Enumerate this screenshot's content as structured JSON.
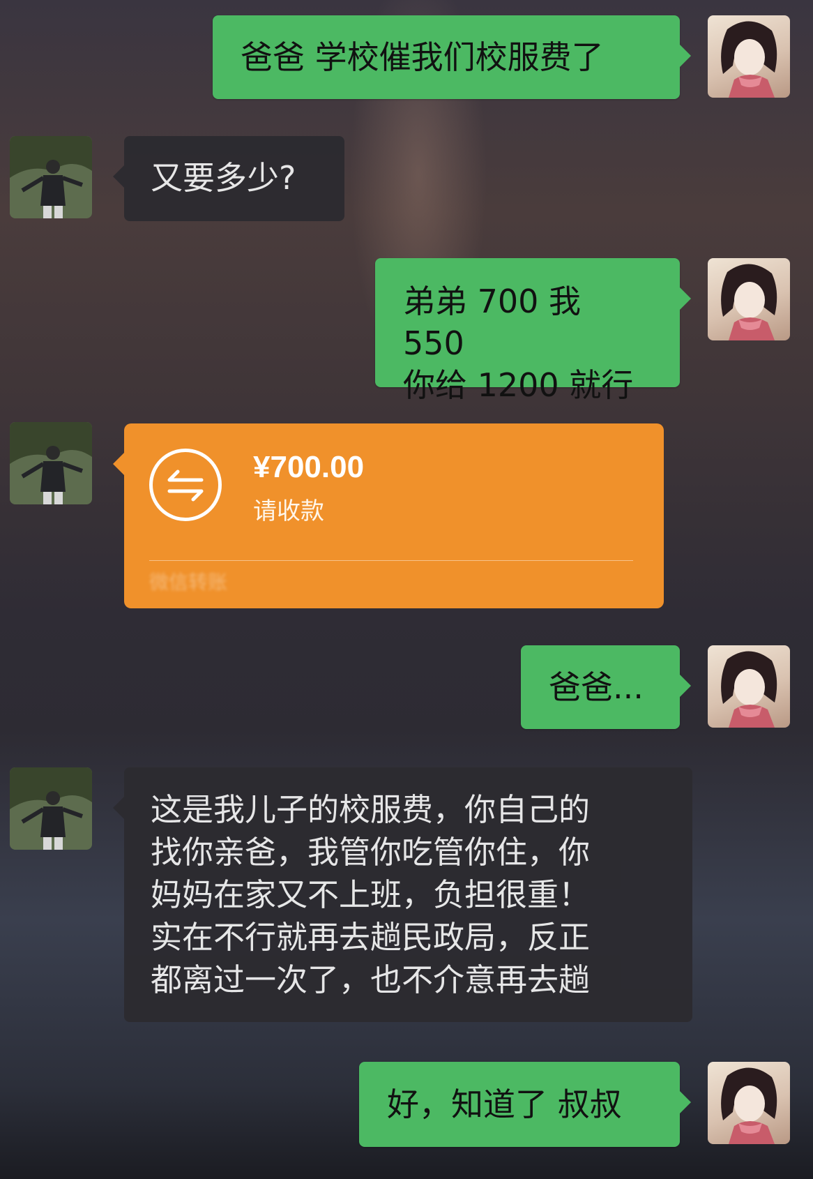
{
  "messages": [
    {
      "sender": "me",
      "text": "爸爸 学校催我们校服费了"
    },
    {
      "sender": "dad",
      "text": "又要多少?"
    },
    {
      "sender": "me",
      "lines": [
        "弟弟 700 我 550",
        "你给 1200 就行"
      ]
    },
    {
      "sender": "dad",
      "type": "transfer",
      "amount": "¥700.00",
      "note": "请收款",
      "footer": "微信转账"
    },
    {
      "sender": "me",
      "text": "爸爸..."
    },
    {
      "sender": "dad",
      "lines": [
        "这是我儿子的校服费，你自己的",
        "找你亲爸，我管你吃管你住，你",
        "妈妈在家又不上班，负担很重！",
        "实在不行就再去趟民政局，反正",
        "都离过一次了，也不介意再去趟"
      ]
    },
    {
      "sender": "me",
      "text": "好，知道了 叔叔"
    }
  ],
  "colors": {
    "sent": "#4cb963",
    "received": "#2c2b30",
    "transfer": "#f0912b"
  },
  "icons": {
    "transfer": "transfer-arrows-icon"
  }
}
